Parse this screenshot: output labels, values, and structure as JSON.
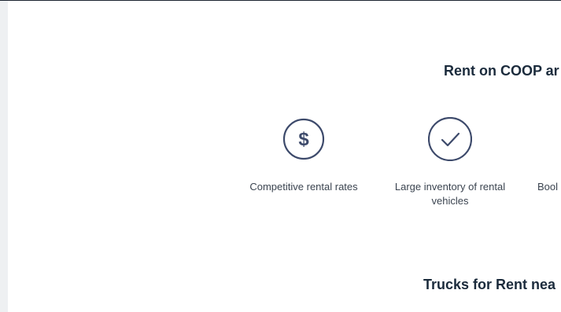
{
  "section": {
    "title": "Rent on COOP ar"
  },
  "features": [
    {
      "icon": "dollar-icon",
      "label": "Competitive rental rates"
    },
    {
      "icon": "checkmark-icon",
      "label": "Large inventory of rental vehicles"
    },
    {
      "icon": "",
      "label": "Bool"
    }
  ],
  "trucks": {
    "title": "Trucks for Rent nea"
  },
  "colors": {
    "icon_stroke": "#3d4a6b",
    "heading": "#1b2b3c",
    "text": "#3b4450"
  }
}
